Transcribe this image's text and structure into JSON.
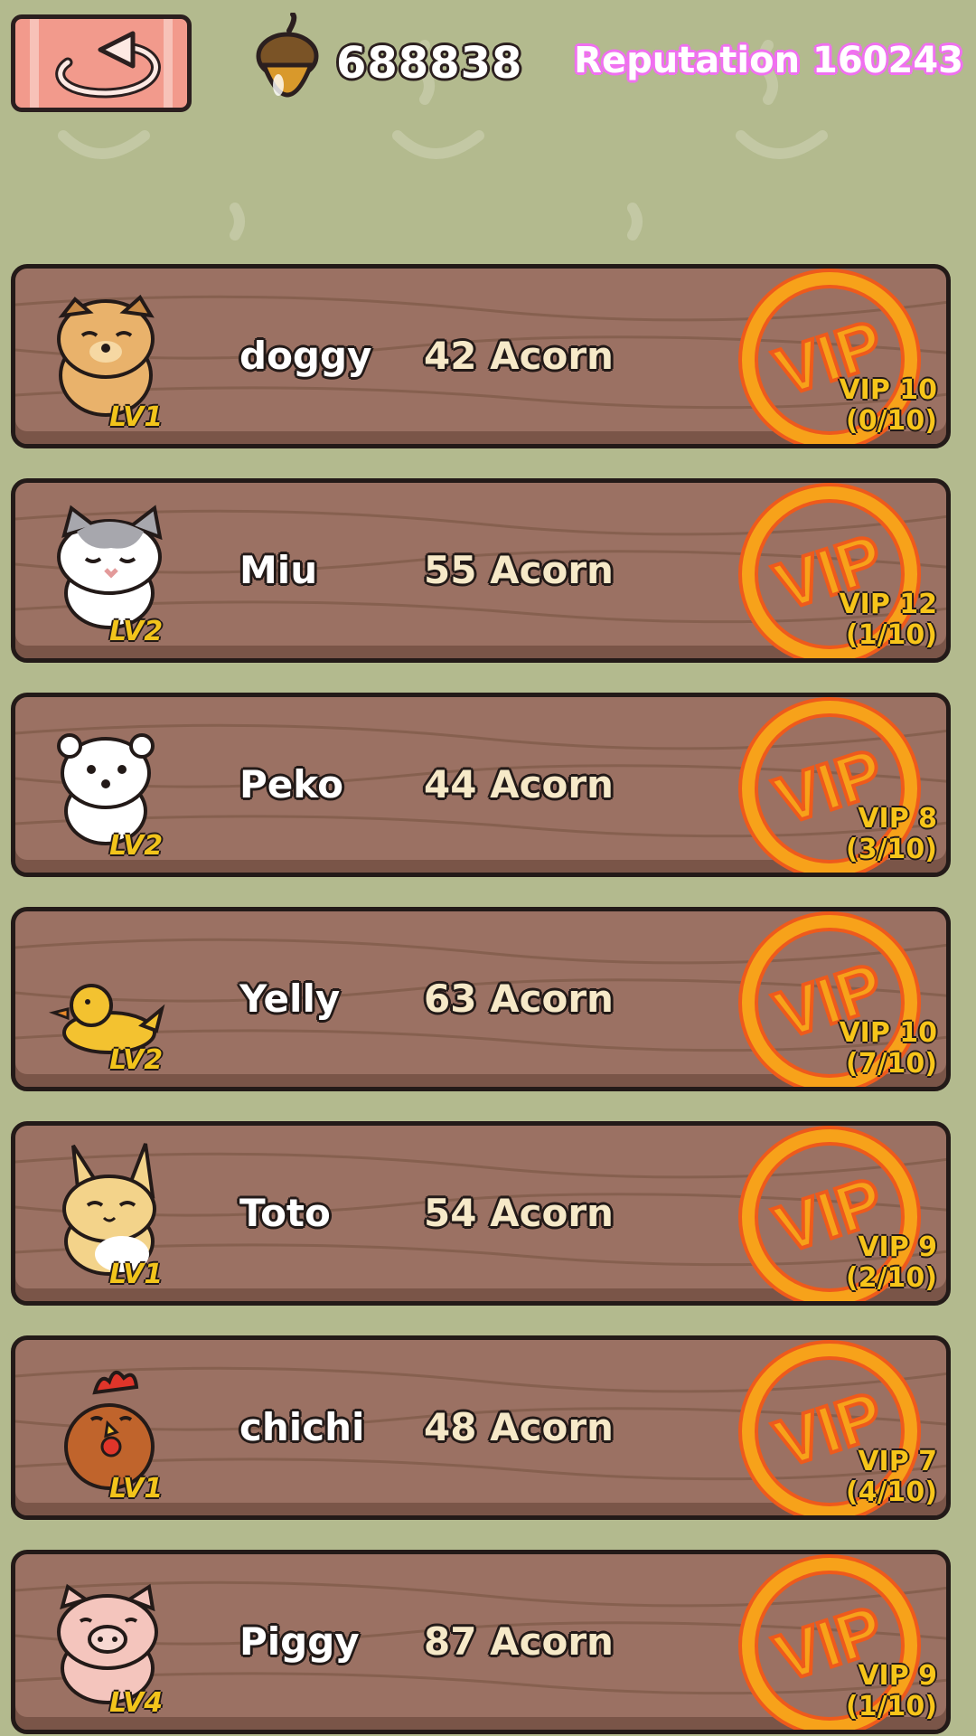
{
  "header": {
    "back_icon": "undo-arrow-icon",
    "acorn_icon": "acorn-icon",
    "acorn_count": "688838",
    "reputation": "Reputation 160243"
  },
  "colors": {
    "background": "#b3ba8e",
    "plank": "#9b7163",
    "vip_orange": "#f7a21a",
    "vip_red": "#ee5a1c",
    "level_yellow": "#f2c41b",
    "reputation_pink": "#f070f0"
  },
  "pets": [
    {
      "name": "doggy",
      "price": "42 Acorn",
      "level": "LV1",
      "vip_label": "VIP",
      "vip_level": "VIP 10",
      "vip_progress": "(0/10)",
      "icon": "dog-icon"
    },
    {
      "name": "Miu",
      "price": "55 Acorn",
      "level": "LV2",
      "vip_label": "VIP",
      "vip_level": "VIP 12",
      "vip_progress": "(1/10)",
      "icon": "cat-icon"
    },
    {
      "name": "Peko",
      "price": "44 Acorn",
      "level": "LV2",
      "vip_label": "VIP",
      "vip_level": "VIP 8",
      "vip_progress": "(3/10)",
      "icon": "bear-icon"
    },
    {
      "name": "Yelly",
      "price": "63 Acorn",
      "level": "LV2",
      "vip_label": "VIP",
      "vip_level": "VIP 10",
      "vip_progress": "(7/10)",
      "icon": "duck-icon"
    },
    {
      "name": "Toto",
      "price": "54 Acorn",
      "level": "LV1",
      "vip_label": "VIP",
      "vip_level": "VIP 9",
      "vip_progress": "(2/10)",
      "icon": "rabbit-icon"
    },
    {
      "name": "chichi",
      "price": "48 Acorn",
      "level": "LV1",
      "vip_label": "VIP",
      "vip_level": "VIP 7",
      "vip_progress": "(4/10)",
      "icon": "chicken-icon"
    },
    {
      "name": "Piggy",
      "price": "87 Acorn",
      "level": "LV4",
      "vip_label": "VIP",
      "vip_level": "VIP 9",
      "vip_progress": "(1/10)",
      "icon": "pig-icon"
    }
  ]
}
